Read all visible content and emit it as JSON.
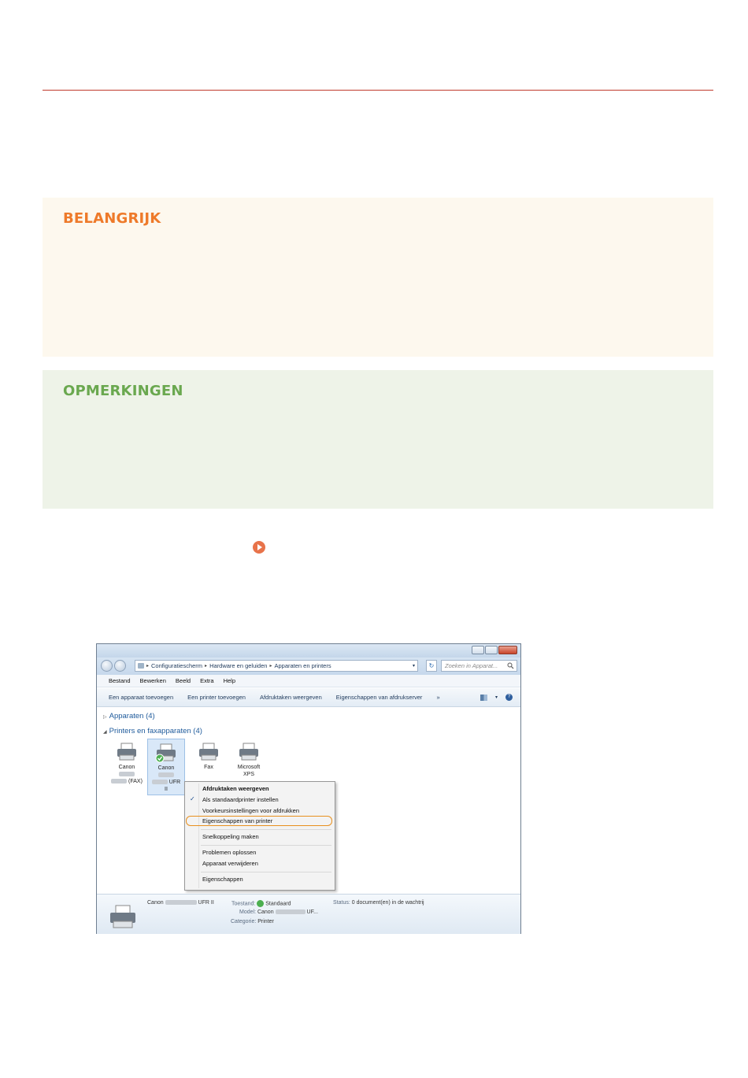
{
  "boxes": {
    "important_title": "BELANGRIJK",
    "notes_title": "OPMERKINGEN"
  },
  "colors": {
    "rule": "#c0392b",
    "important_title": "#ee7a2a",
    "notes_title": "#6aa84f",
    "step_arrow": "#e8734a",
    "highlight": "#e8901e"
  },
  "window": {
    "address": {
      "crumb1": "Configuratiescherm",
      "crumb2": "Hardware en geluiden",
      "crumb3": "Apparaten en printers"
    },
    "search_placeholder": "Zoeken in Apparat...",
    "menu": [
      "Bestand",
      "Bewerken",
      "Beeld",
      "Extra",
      "Help"
    ],
    "toolbar": [
      "Een apparaat toevoegen",
      "Een printer toevoegen",
      "Afdruktaken weergeven",
      "Eigenschappen van afdrukserver",
      "»"
    ],
    "groups": {
      "devices": "Apparaten (4)",
      "printers": "Printers en faxapparaten (4)"
    },
    "printers": [
      {
        "line1": "Canon",
        "line3": "(FAX)"
      },
      {
        "line1": "Canon",
        "line3": "UFR",
        "line4": "II"
      },
      {
        "line1": "Fax"
      },
      {
        "line1": "Microsoft",
        "line2": "XPS"
      }
    ],
    "context_menu": [
      "Afdruktaken weergeven",
      "Als standaardprinter instellen",
      "Voorkeursinstellingen voor afdrukken",
      "Eigenschappen van printer",
      "Snelkoppeling maken",
      "Problemen oplossen",
      "Apparaat verwijderen",
      "Eigenschappen"
    ],
    "details": {
      "name_prefix": "Canon",
      "name_suffix": "UFR II",
      "state_label": "Toestand:",
      "state_value": "Standaard",
      "status_label": "Status:",
      "status_value": "0 document(en) in de wachtrij",
      "model_label": "Model:",
      "model_prefix": "Canon",
      "model_suffix": "UF...",
      "category_label": "Categorie:",
      "category_value": "Printer"
    }
  }
}
